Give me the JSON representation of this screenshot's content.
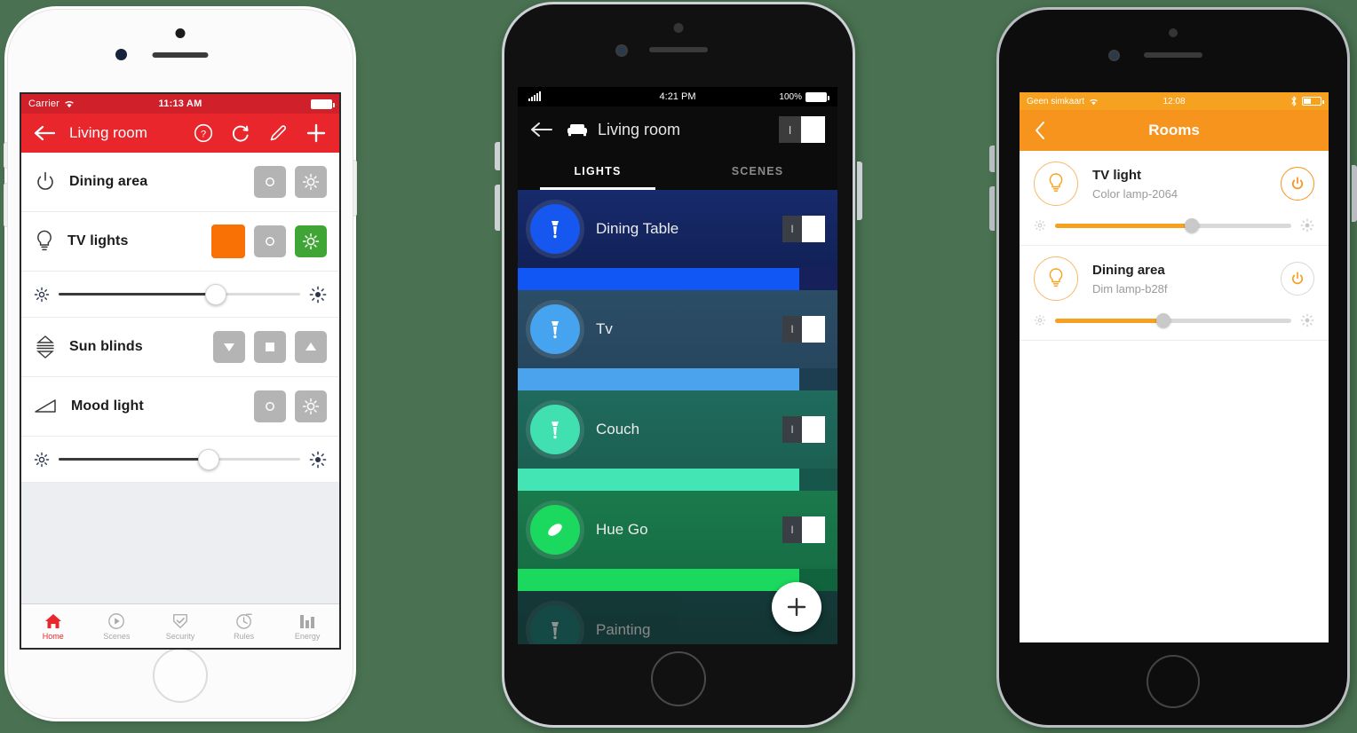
{
  "background_color": "#4a7252",
  "phone1": {
    "device": "white-iphone",
    "status": {
      "carrier": "Carrier",
      "time": "11:13 AM",
      "wifi_icon": "wifi-icon",
      "battery_icon": "battery-full-icon"
    },
    "nav": {
      "back_icon": "back-arrow-icon",
      "title": "Living room",
      "help_icon": "help-circle-icon",
      "refresh_icon": "refresh-icon",
      "edit_icon": "pencil-icon",
      "add_icon": "plus-icon",
      "bar_color": "#e8262c"
    },
    "rows": [
      {
        "name": "Dining area",
        "icon": "power-icon",
        "type": "switch",
        "buttons": [
          {
            "icon": "circle-off-icon",
            "state": "off",
            "color": "#b4b4b4"
          },
          {
            "icon": "sun-on-icon",
            "state": "off",
            "color": "#b4b4b4"
          }
        ]
      },
      {
        "name": "TV lights",
        "icon": "bulb-icon",
        "type": "color-dimmer",
        "swatch_color": "#f97005",
        "buttons": [
          {
            "icon": "circle-off-icon",
            "state": "off",
            "color": "#b4b4b4"
          },
          {
            "icon": "sun-on-icon",
            "state": "on",
            "color": "#3fa535"
          }
        ],
        "slider": {
          "value": 65,
          "left_icon": "brightness-low-icon",
          "right_icon": "brightness-high-icon"
        }
      },
      {
        "name": "Sun blinds",
        "icon": "blinds-icon",
        "type": "blinds",
        "buttons": [
          {
            "icon": "down-triangle-icon",
            "state": "off",
            "color": "#b4b4b4"
          },
          {
            "icon": "stop-square-icon",
            "state": "off",
            "color": "#b4b4b4"
          },
          {
            "icon": "up-triangle-icon",
            "state": "off",
            "color": "#b4b4b4"
          }
        ]
      },
      {
        "name": "Mood light",
        "icon": "dimmer-ramp-icon",
        "type": "dimmer",
        "buttons": [
          {
            "icon": "circle-off-icon",
            "state": "off",
            "color": "#b4b4b4"
          },
          {
            "icon": "sun-on-icon",
            "state": "off",
            "color": "#b4b4b4"
          }
        ],
        "slider": {
          "value": 62,
          "left_icon": "brightness-low-icon",
          "right_icon": "brightness-high-icon"
        }
      }
    ],
    "tabbar": {
      "active": "Home",
      "items": [
        {
          "label": "Home",
          "icon": "home-icon",
          "active": true
        },
        {
          "label": "Scenes",
          "icon": "play-circle-icon",
          "active": false
        },
        {
          "label": "Security",
          "icon": "shield-check-icon",
          "active": false
        },
        {
          "label": "Rules",
          "icon": "clock-icon",
          "active": false
        },
        {
          "label": "Energy",
          "icon": "bar-chart-icon",
          "active": false
        }
      ]
    }
  },
  "phone2": {
    "device": "black-iphone",
    "status": {
      "signal_icon": "signal-bars-icon",
      "time": "4:21 PM",
      "battery_percent": "100%",
      "battery_icon": "battery-full-icon"
    },
    "nav": {
      "back_icon": "back-arrow-icon",
      "room_icon": "sofa-icon",
      "title": "Living room",
      "toggle": {
        "on_label": "I",
        "state": "on"
      }
    },
    "tabs": [
      {
        "label": "LIGHTS",
        "active": true
      },
      {
        "label": "SCENES",
        "active": false
      }
    ],
    "lights": [
      {
        "name": "Dining Table",
        "icon": "spotlight-icon",
        "circle_color": "#1657f0",
        "row_bg_from": "#172a6b",
        "row_bg_to": "#101f52",
        "bar_color": "#1157f5",
        "bar_pct": 88,
        "bar_track": "#16205a",
        "toggle": {
          "on_label": "I",
          "state": "on"
        }
      },
      {
        "name": "Tv",
        "icon": "spotlight-icon",
        "circle_color": "#45a3f0",
        "row_bg_from": "#2b4d66",
        "row_bg_to": "#25455c",
        "bar_color": "#4aa3ec",
        "bar_pct": 88,
        "bar_track": "#1d3d50",
        "toggle": {
          "on_label": "I",
          "state": "on"
        }
      },
      {
        "name": "Couch",
        "icon": "spotlight-icon",
        "circle_color": "#41e0b0",
        "row_bg_from": "#1f6b5d",
        "row_bg_to": "#1b5c50",
        "bar_color": "#43e5b4",
        "bar_pct": 88,
        "bar_track": "#17574b",
        "toggle": {
          "on_label": "I",
          "state": "on"
        }
      },
      {
        "name": "Hue Go",
        "icon": "hue-go-icon",
        "circle_color": "#1bd95e",
        "row_bg_from": "#1a7a4c",
        "row_bg_to": "#166b43",
        "bar_color": "#1bd95e",
        "bar_pct": 88,
        "bar_track": "#11633d",
        "toggle": {
          "on_label": "I",
          "state": "on"
        }
      },
      {
        "name": "Painting",
        "icon": "spotlight-icon",
        "circle_color": "#1d7c75",
        "row_bg_from": "#1b5e5c",
        "row_bg_to": "#17524f",
        "bar_color": "#1aa07a",
        "bar_pct": 88,
        "bar_track": "#134a46",
        "toggle": {
          "on_label": "I",
          "state": "on"
        }
      }
    ],
    "fab": {
      "icon": "plus-icon",
      "label": "+"
    }
  },
  "phone3": {
    "device": "black-iphone",
    "status": {
      "carrier": "Geen simkaart",
      "wifi_icon": "wifi-icon",
      "time": "12:08",
      "bluetooth_icon": "bluetooth-icon",
      "battery_icon": "battery-half-icon"
    },
    "nav": {
      "back_icon": "chevron-left-icon",
      "title": "Rooms",
      "bar_color": "#f6941d"
    },
    "rows": [
      {
        "name": "TV light",
        "subtitle": "Color lamp-2064",
        "icon": "bulb-icon",
        "power": {
          "icon": "power-icon",
          "state": "on",
          "color": "#f6941d"
        },
        "slider": {
          "value": 58,
          "left_icon": "brightness-low-icon",
          "right_icon": "brightness-high-icon",
          "fill_color": "#f6a11f"
        }
      },
      {
        "name": "Dining area",
        "subtitle": "Dim lamp-b28f",
        "icon": "bulb-icon",
        "power": {
          "icon": "power-icon",
          "state": "off",
          "color": "#d8d8d8"
        },
        "slider": {
          "value": 46,
          "left_icon": "brightness-low-icon",
          "right_icon": "brightness-high-icon",
          "fill_color": "#f6a11f"
        }
      }
    ]
  }
}
